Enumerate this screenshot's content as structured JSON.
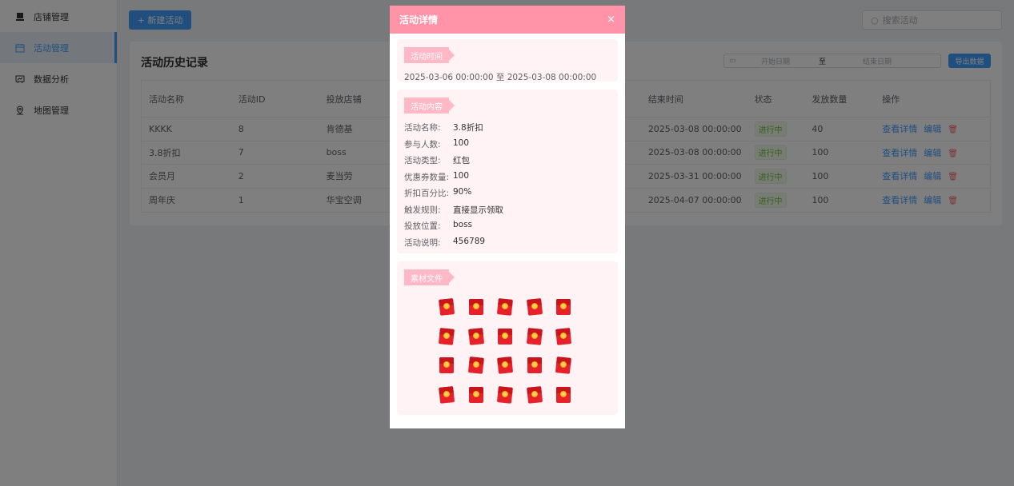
{
  "sidebar": {
    "items": [
      {
        "label": "店铺管理",
        "icon": "store-icon"
      },
      {
        "label": "活动管理",
        "icon": "calendar-icon",
        "active": true
      },
      {
        "label": "数据分析",
        "icon": "chart-icon"
      },
      {
        "label": "地图管理",
        "icon": "map-pin-icon"
      }
    ]
  },
  "toolbar": {
    "new_label": "+ 新建活动",
    "search_placeholder": "搜索活动"
  },
  "history": {
    "title": "活动历史记录",
    "date_start_placeholder": "开始日期",
    "date_sep": "至",
    "date_end_placeholder": "结束日期",
    "export_label": "导出数据",
    "columns": [
      "活动名称",
      "活动ID",
      "投放店铺",
      "结束时间",
      "状态",
      "发放数量",
      "操作"
    ],
    "rows": [
      {
        "name": "KKKK",
        "id": "8",
        "store": "肯德基",
        "end": "2025-03-08 00:00:00",
        "status": "进行中",
        "count": "40"
      },
      {
        "name": "3.8折扣",
        "id": "7",
        "store": "boss",
        "end": "2025-03-08 00:00:00",
        "status": "进行中",
        "count": "100"
      },
      {
        "name": "会员月",
        "id": "2",
        "store": "麦当劳",
        "end": "2025-03-31 00:00:00",
        "status": "进行中",
        "count": "100"
      },
      {
        "name": "周年庆",
        "id": "1",
        "store": "华宝空调",
        "end": "2025-04-07 00:00:00",
        "status": "进行中",
        "count": "100"
      }
    ],
    "op_view": "查看详情",
    "op_edit": "编辑"
  },
  "modal": {
    "title": "活动详情",
    "close": "×",
    "time_section": {
      "label": "活动时间",
      "value": "2025-03-06 00:00:00 至 2025-03-08 00:00:00"
    },
    "content_section": {
      "label": "活动内容",
      "fields": [
        {
          "k": "活动名称:",
          "v": "3.8折扣"
        },
        {
          "k": "参与人数:",
          "v": "100"
        },
        {
          "k": "活动类型:",
          "v": "红包"
        },
        {
          "k": "优惠券数量:",
          "v": "100"
        },
        {
          "k": "折扣百分比:",
          "v": "90%"
        },
        {
          "k": "触发规则:",
          "v": "直接显示领取"
        },
        {
          "k": "投放位置:",
          "v": "boss"
        },
        {
          "k": "活动说明:",
          "v": "456789"
        }
      ]
    },
    "material_section": {
      "label": "素材文件",
      "item_icon": "red-envelope-icon",
      "rows": 4,
      "cols": 5
    }
  },
  "colors": {
    "primary": "#409eff",
    "modal_header": "#ff94a8",
    "section_bg": "#fff3f5",
    "section_label": "#ffb8c6",
    "status_green": "#67c23a",
    "danger": "#f56c6c"
  }
}
